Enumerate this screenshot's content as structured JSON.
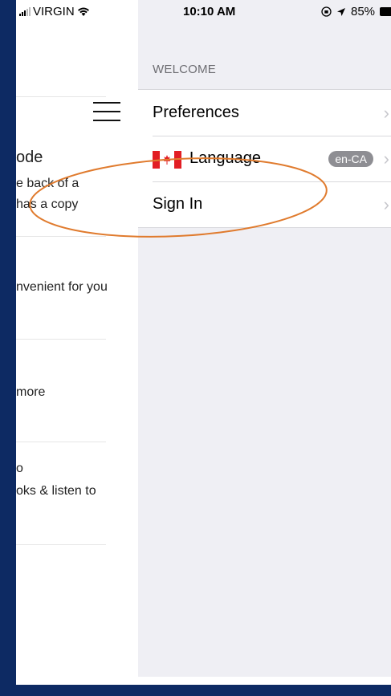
{
  "status_bar": {
    "carrier": "VIRGIN",
    "time": "10:10 AM",
    "battery": "85%"
  },
  "background_page": {
    "lines": [
      "ode",
      "e back of a",
      "has a copy",
      "nvenient for you",
      "more",
      "o",
      "oks & listen to"
    ]
  },
  "drawer": {
    "section_title": "WELCOME",
    "items": [
      {
        "label": "Preferences"
      },
      {
        "label": "Language",
        "badge": "en-CA"
      },
      {
        "label": "Sign In"
      }
    ]
  },
  "colors": {
    "frame": "#0d2a63",
    "drawer_bg": "#efeff4",
    "annotation": "#e07b2e",
    "flag_red": "#e21e24"
  }
}
